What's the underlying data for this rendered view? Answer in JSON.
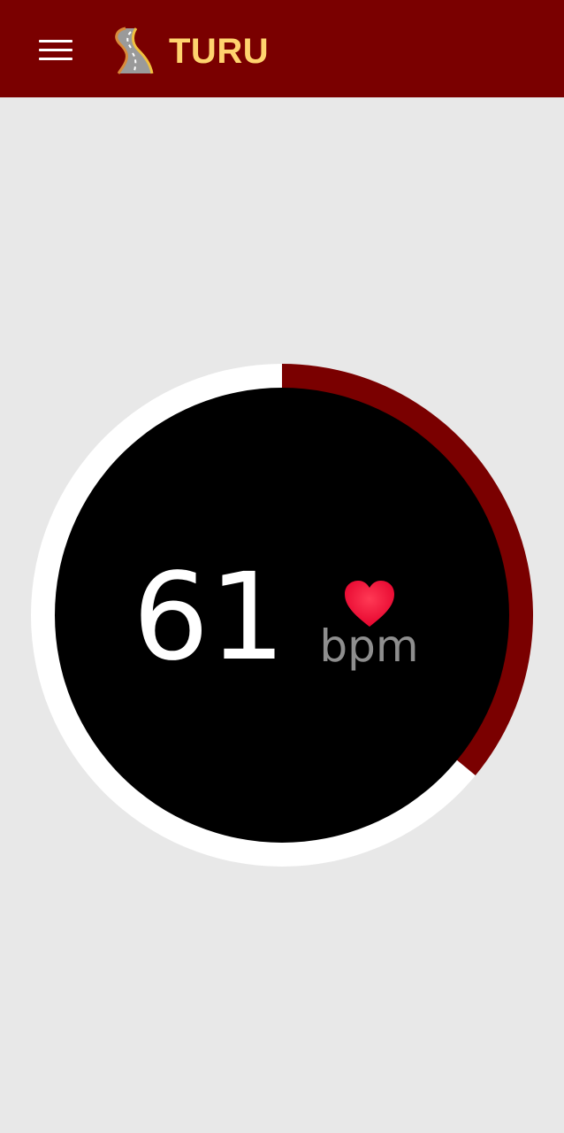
{
  "app_bar": {
    "title": "TURU",
    "menu_icon": "hamburger-menu-icon",
    "logo_icon": "road-logo-icon",
    "background_color": "#7a0000",
    "title_color": "#ffd36e"
  },
  "heart_rate": {
    "value": "61",
    "unit": "bpm",
    "unit_icon": "heart-icon",
    "progress_fraction": 0.36,
    "progress_color": "#7a0000",
    "track_color": "#ffffff",
    "dial_color": "#000000"
  }
}
